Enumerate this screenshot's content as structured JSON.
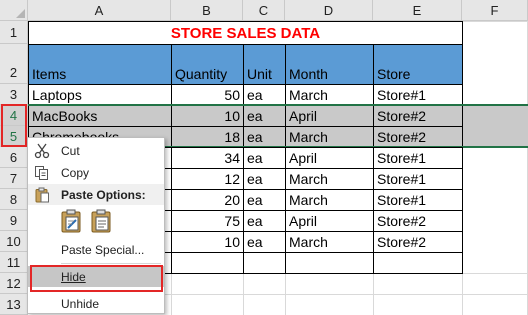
{
  "columns": [
    "A",
    "B",
    "C",
    "D",
    "E",
    "F"
  ],
  "rows": [
    "1",
    "2",
    "3",
    "4",
    "5",
    "6",
    "7",
    "8",
    "9",
    "10",
    "11",
    "12",
    "13"
  ],
  "title": "STORE SALES DATA",
  "headers": [
    "Items",
    "Quantity",
    "Unit",
    "Month",
    "Store"
  ],
  "data": [
    [
      "Laptops",
      "50",
      "ea",
      "March",
      "Store#1"
    ],
    [
      "MacBooks",
      "10",
      "ea",
      "April",
      "Store#2"
    ],
    [
      "Chromebooks",
      "18",
      "ea",
      "March",
      "Store#2"
    ],
    [
      "",
      "34",
      "ea",
      "April",
      "Store#1"
    ],
    [
      "",
      "12",
      "ea",
      "March",
      "Store#1"
    ],
    [
      "",
      "20",
      "ea",
      "March",
      "Store#1"
    ],
    [
      "",
      "75",
      "ea",
      "April",
      "Store#2"
    ],
    [
      "",
      "10",
      "ea",
      "March",
      "Store#2"
    ]
  ],
  "colors": {
    "header_fill": "#5b9bd5",
    "selected_fill": "#c9c9c9",
    "highlight_red": "#e32626",
    "title_red": "#ff0000"
  },
  "menu": {
    "cut": "Cut",
    "copy": "Copy",
    "paste_options": "Paste Options:",
    "paste_special": "Paste Special...",
    "hide": "Hide",
    "unhide": "Unhide"
  },
  "icons": {
    "cut": "scissors-icon",
    "copy": "copy-icon",
    "paste": "clipboard-icon"
  }
}
